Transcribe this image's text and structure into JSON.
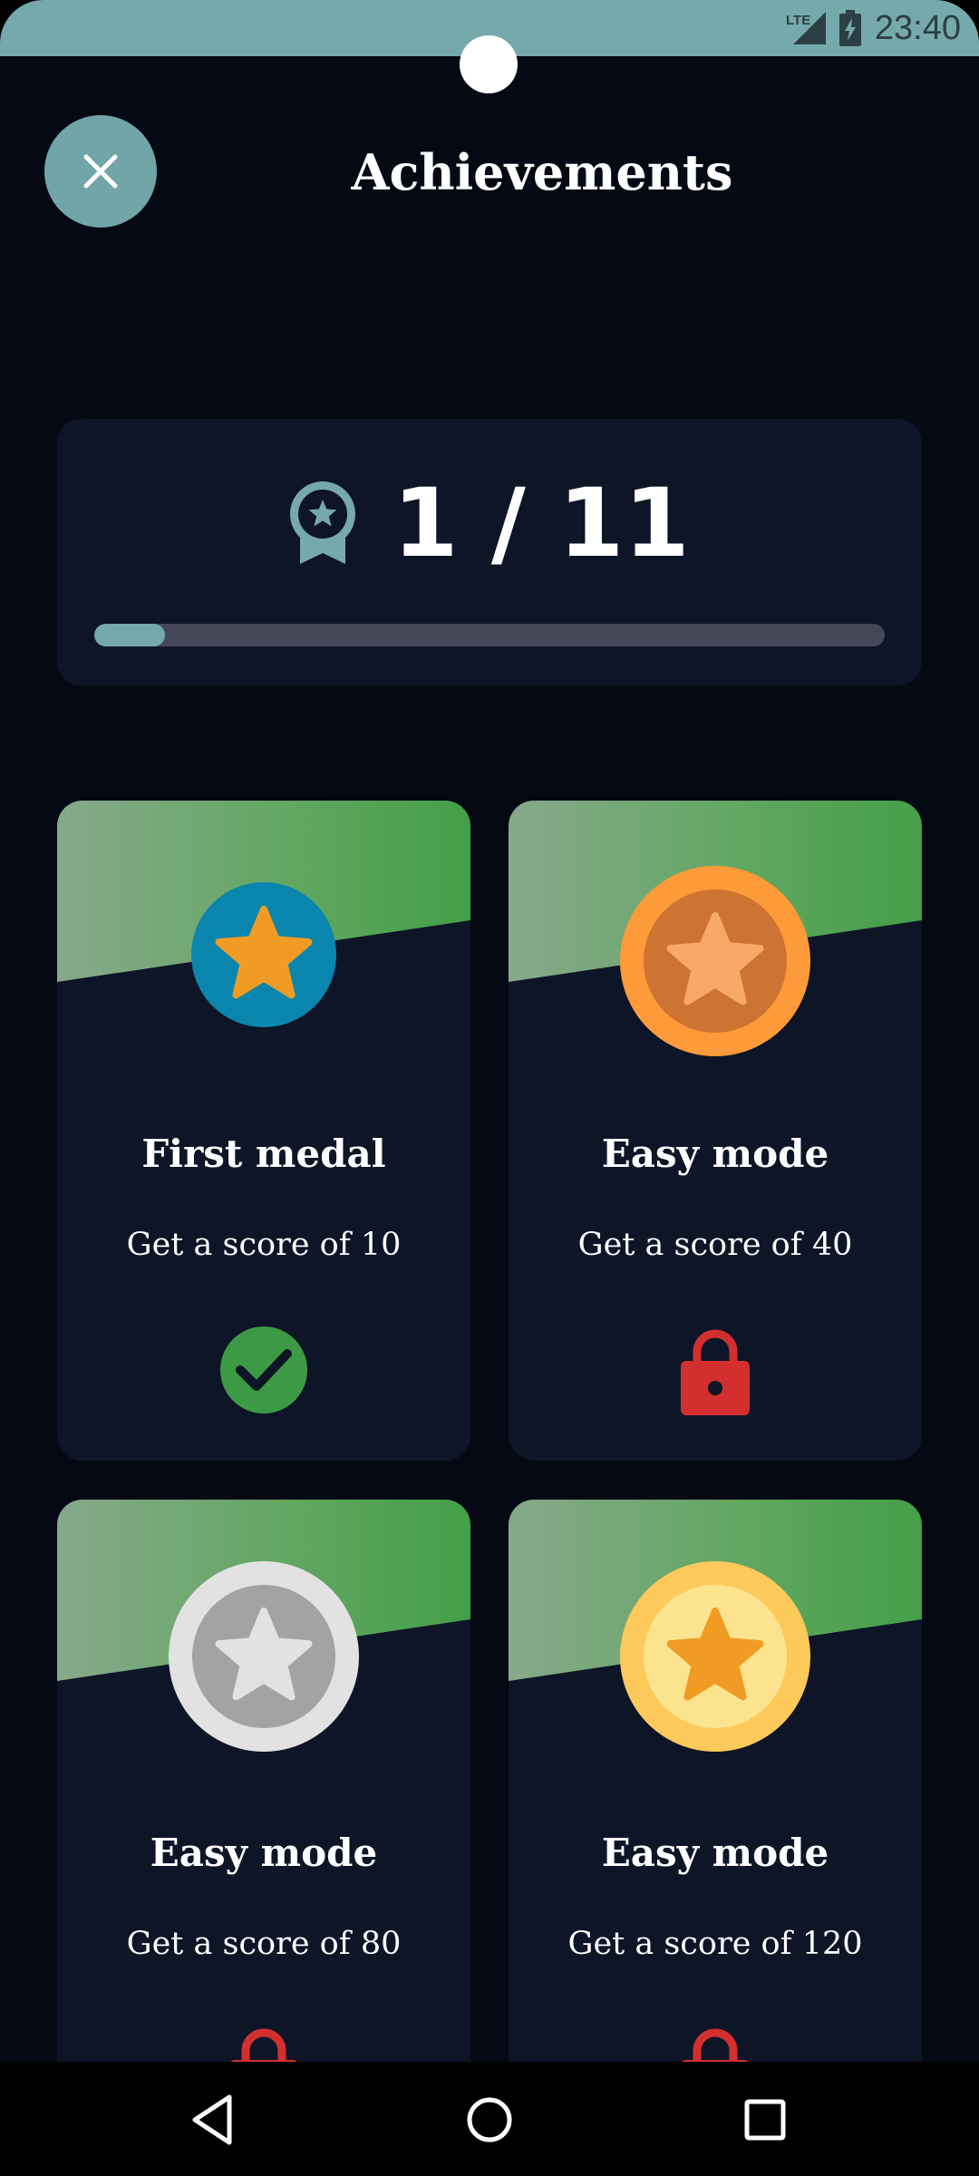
{
  "status_bar": {
    "network": "LTE",
    "time": "23:40",
    "icons": [
      "lte-signal-icon",
      "battery-charging-icon"
    ]
  },
  "header": {
    "title": "Achievements",
    "close_icon": "close-icon"
  },
  "progress": {
    "unlocked": 1,
    "total": 11,
    "label": "1 / 11",
    "fraction": 0.09,
    "icon": "award-ribbon-icon"
  },
  "achievements": [
    {
      "title": "First medal",
      "description": "Get a score of 10",
      "medal": "blue-star-medal",
      "status": "unlocked",
      "status_icon": "check-circle-icon"
    },
    {
      "title": "Easy mode",
      "description": "Get a score of 40",
      "medal": "bronze-star-medal",
      "status": "locked",
      "status_icon": "lock-icon"
    },
    {
      "title": "Easy mode",
      "description": "Get a score of 80",
      "medal": "silver-star-medal",
      "status": "locked",
      "status_icon": "lock-icon"
    },
    {
      "title": "Easy mode",
      "description": "Get a score of 120",
      "medal": "gold-star-medal",
      "status": "locked",
      "status_icon": "lock-icon"
    }
  ],
  "nav_bar": {
    "icons": [
      "back-icon",
      "home-icon",
      "recents-icon"
    ]
  },
  "colors": {
    "accent": "#76a9ac",
    "background": "#050913",
    "card": "#0e1527",
    "success": "#3d9a44",
    "locked": "#d32f2f"
  }
}
